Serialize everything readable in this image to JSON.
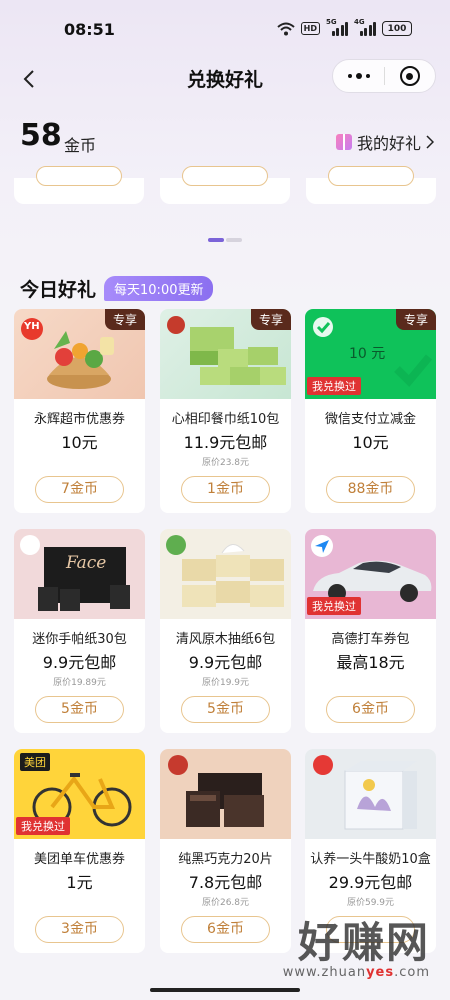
{
  "status_bar": {
    "time": "08:51",
    "hd": "HD",
    "net1": "5G",
    "net2": "4G",
    "battery": "100"
  },
  "nav": {
    "title": "兑换好礼"
  },
  "balance": {
    "amount": "58",
    "unit": "金币",
    "my_gifts_label": "我的好礼"
  },
  "section": {
    "title": "今日好礼",
    "update_text": "每天10:00更新"
  },
  "products": [
    {
      "name": "永辉超市优惠券",
      "price": "10元",
      "original_price": "",
      "cost": "7金币",
      "tag_exclusive": "专享",
      "tag_redeemed": "",
      "logo": "YH",
      "image": "grocery-basket"
    },
    {
      "name": "心相印餐巾纸10包",
      "price": "11.9元包邮",
      "original_price": "原价23.8元",
      "cost": "1金币",
      "tag_exclusive": "专享",
      "tag_redeemed": "",
      "image": "tissue-packs"
    },
    {
      "name": "微信支付立减金",
      "price": "10元",
      "original_price": "",
      "cost": "88金币",
      "tag_exclusive": "专享",
      "tag_redeemed": "我兑换过",
      "image_text": "10 元",
      "image": "wechat-voucher"
    },
    {
      "name": "迷你手帕纸30包",
      "price": "9.9元包邮",
      "original_price": "原价19.89元",
      "cost": "5金币",
      "tag_exclusive": "",
      "tag_redeemed": "",
      "image_text": "Face",
      "image": "black-tissue-box"
    },
    {
      "name": "清风原木抽纸6包",
      "price": "9.9元包邮",
      "original_price": "原价19.9元",
      "cost": "5金币",
      "tag_exclusive": "",
      "tag_redeemed": "",
      "image": "facial-tissue-packs"
    },
    {
      "name": "高德打车券包",
      "price": "最高18元",
      "original_price": "",
      "cost": "6金币",
      "tag_exclusive": "",
      "tag_redeemed": "我兑换过",
      "image": "silver-car"
    },
    {
      "name": "美团单车优惠券",
      "price": "1元",
      "original_price": "",
      "cost": "3金币",
      "tag_exclusive": "",
      "tag_redeemed": "我兑换过",
      "logo": "美团",
      "image": "yellow-bike"
    },
    {
      "name": "纯黑巧克力20片",
      "price": "7.8元包邮",
      "original_price": "原价26.8元",
      "cost": "6金币",
      "tag_exclusive": "",
      "tag_redeemed": "",
      "image": "dark-chocolate"
    },
    {
      "name": "认养一头牛酸奶10盒",
      "price": "29.9元包邮",
      "original_price": "原价59.9元",
      "cost": "",
      "tag_exclusive": "",
      "tag_redeemed": "",
      "image": "yogurt-box"
    }
  ],
  "watermark": {
    "cn": "好赚网",
    "url_pre": "www.zhuan",
    "url_mid": "yes",
    "url_post": ".com"
  },
  "colors": {
    "accent_purple": "#8b6ff0",
    "button_border": "#e8c58f",
    "button_text": "#c0803a",
    "redeemed_red": "#e03232",
    "exclusive_brown": "#5a2a1c"
  }
}
